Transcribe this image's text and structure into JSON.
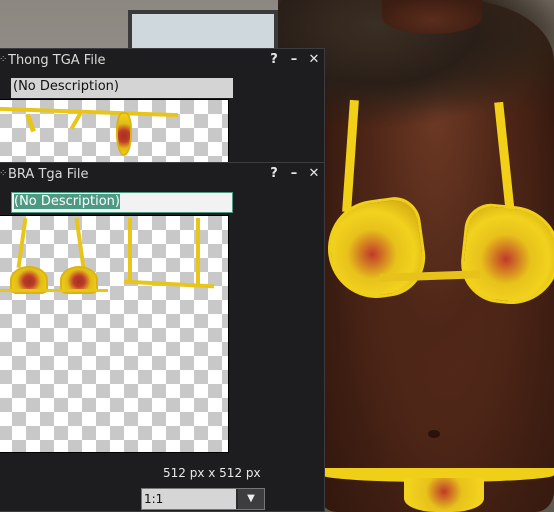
{
  "thong_floater": {
    "title": "Thong TGA File",
    "description": "(No Description)",
    "help_label": "?",
    "minimize_label": "–",
    "close_label": "✕"
  },
  "bra_floater": {
    "title": "BRA Tga File",
    "description": "(No Description)",
    "help_label": "?",
    "minimize_label": "–",
    "close_label": "✕",
    "dimensions": "512 px x 512 px",
    "zoom_value": "1:1"
  },
  "colors": {
    "panel_bg": "#1d1d1f",
    "selection": "#4d9a82",
    "bikini_gold": "#e8c51a"
  },
  "icons": {
    "help": "question-icon",
    "minimize": "minimize-icon",
    "close": "close-icon",
    "dropdown": "chevron-down-icon",
    "grip": "drag-handle-icon"
  }
}
